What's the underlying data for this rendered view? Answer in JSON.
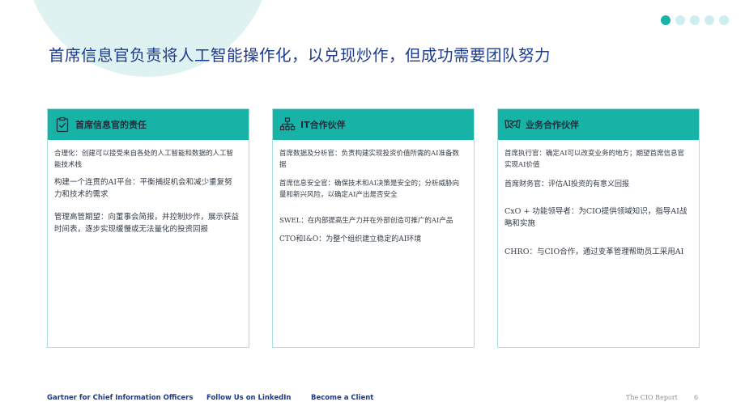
{
  "title": "首席信息官负责将人工智能操作化，以兑现炒作，但成功需要团队努力",
  "pagination": {
    "count": 5,
    "active": 0
  },
  "cards": [
    {
      "title": "首席信息官的责任",
      "icon": "clipboard-check-icon",
      "items": [
        "合理化：创建可以接受来自各处的人工智能和数据的人工智能技术栈",
        "构建一个连贯的AI平台：平衡捕捉机会和减少重复努力和技术的需求",
        "管理高管期望：向董事会简报，并控制炒作，展示获益时间表，逐步实现缓慢或无法量化的投资回报"
      ]
    },
    {
      "title": "IT合作伙伴",
      "icon": "org-chart-icon",
      "items": [
        "首席数据及分析官：负责构建实现投资价值所需的AI准备数据",
        "首席信息安全官：确保技术和AI决策是安全的；分析威胁向量和新兴风险，以确定AI产出是否安全",
        "SWEL：在内部提高生产力并在外部创造可推广的AI产品",
        "CTO和I&O：为整个组织建立稳定的AI环境"
      ]
    },
    {
      "title": "业务合作伙伴",
      "icon": "handshake-icon",
      "items": [
        "首席执行官：确定AI可以改变业务的地方；期望首席信息官实现AI价值",
        "首席财务官：评估AI投资的有意义回报",
        "CxO + 功能领导者：为CIO提供领域知识，指导AI战略和实施",
        "CHRO：与CIO合作，通过变革管理帮助员工采用AI"
      ]
    }
  ],
  "footer": {
    "links": [
      "Gartner for Chief Information Officers",
      "Follow Us on LinkedIn",
      "Become a Client"
    ],
    "report": "The CIO Report",
    "page": "6"
  }
}
